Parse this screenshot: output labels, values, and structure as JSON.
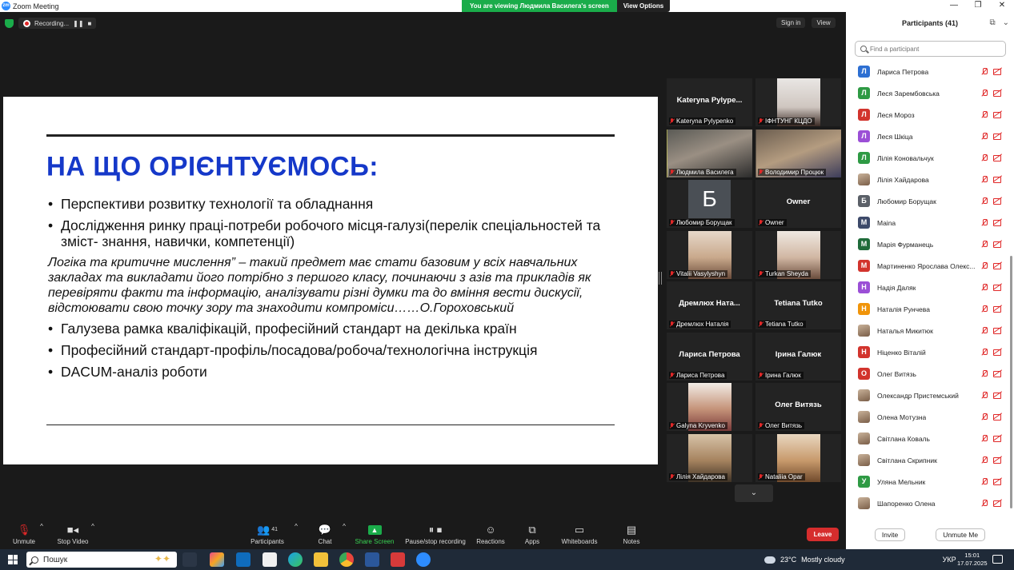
{
  "window": {
    "title": "Zoom Meeting",
    "logo_text": "zm"
  },
  "banner": {
    "viewing": "You are viewing Людмила Василега's screen",
    "view_options": "View Options"
  },
  "window_controls": {
    "minimize": "—",
    "maximize": "❐",
    "close": "✕"
  },
  "recording": {
    "label": "Recording...",
    "pause": "❚❚",
    "stop": "■"
  },
  "top_links": {
    "sign_in": "Sign in",
    "view": "View"
  },
  "slide": {
    "headline": "НА ЩО ОРІЄНТУЄМОСЬ:",
    "bullets_top": [
      "Перспективи розвитку технології та обладнання",
      "Дослідження ринку праці-потреби робочого місця-галузі(перелік спеціальностей та зміст- знання, навички, компетенції)"
    ],
    "quote": "Логіка та критичне мислення” – такий предмет має стати базовим у всіх навчальних закладах та викладати його потрібно з першого класу, починаючи з азів та прикладів як перевіряти факти та інформацію, аналізувати різні думки та до вміння вести дискусії, відстоювати свою точку зору та знаходити компроміси……О.Гороховський",
    "bullets_bottom": [
      "Галузева рамка кваліфікацій, професійний стандарт на декілька країн",
      "Професійний стандарт-профіль/посадова/робоча/технологічна інструкція",
      "DACUM-аналіз роботи"
    ],
    "bullet_char": "•"
  },
  "gallery": [
    {
      "name": "Kateryna Pylype...",
      "label": "Kateryna Pylypenko",
      "kind": "name"
    },
    {
      "name": "",
      "label": "ІФНТУНГ КЦДО",
      "kind": "photo"
    },
    {
      "name": "",
      "label": "Людмила Василега",
      "kind": "photo",
      "active": true
    },
    {
      "name": "",
      "label": "Володимир Процюк",
      "kind": "photo"
    },
    {
      "name": "Б",
      "label": "Любомир Борущак",
      "kind": "letter"
    },
    {
      "name": "Owner",
      "label": "Owner",
      "kind": "name"
    },
    {
      "name": "",
      "label": "Vitalii Vasylyshyn",
      "kind": "photo"
    },
    {
      "name": "",
      "label": "Turkan Sheyda",
      "kind": "photo"
    },
    {
      "name": "Дремлюх  Ната...",
      "label": "Дремлюх Наталія",
      "kind": "name"
    },
    {
      "name": "Tetiana Tutko",
      "label": "Tetiana Tutko",
      "kind": "name"
    },
    {
      "name": "Лариса Петрова",
      "label": "Лариса Петрова",
      "kind": "name"
    },
    {
      "name": "Ірина Галюк",
      "label": "Ірина Галюк",
      "kind": "name"
    },
    {
      "name": "",
      "label": "Galyna Kryvenko",
      "kind": "photo"
    },
    {
      "name": "Олег Витязь",
      "label": "Олег Витязь",
      "kind": "name"
    },
    {
      "name": "",
      "label": "Лілія Хайдарова",
      "kind": "photo"
    },
    {
      "name": "",
      "label": "Nataliia Opar",
      "kind": "photo"
    }
  ],
  "gallery_down": "⌄",
  "participants": {
    "title": "Participants (41)",
    "search_placeholder": "Find a participant",
    "list": [
      {
        "initial": "Л",
        "name": "Лариса Петрова",
        "color": "#2d6fd2"
      },
      {
        "initial": "Л",
        "name": "Леся Зарембовська",
        "color": "#2e9a44"
      },
      {
        "initial": "Л",
        "name": "Леся Мороз",
        "color": "#d2342d"
      },
      {
        "initial": "Л",
        "name": "Леся Шкіца",
        "color": "#9b4fd6"
      },
      {
        "initial": "Л",
        "name": "Лілія Коновальчук",
        "color": "#2e9a44"
      },
      {
        "initial": "",
        "name": "Лілія Хайдарова",
        "color": "photo"
      },
      {
        "initial": "Б",
        "name": "Любомир Борущак",
        "color": "#5b6068"
      },
      {
        "initial": "M",
        "name": "Maina",
        "color": "#3d4a6a"
      },
      {
        "initial": "М",
        "name": "Марія Фурманець",
        "color": "#1f6b3a"
      },
      {
        "initial": "М",
        "name": "Мартиненко Ярослава Олекс...",
        "color": "#d2342d"
      },
      {
        "initial": "Н",
        "name": "Надія Даляк",
        "color": "#9b4fd6"
      },
      {
        "initial": "Н",
        "name": "Наталія Рунчева",
        "color": "#f0940a"
      },
      {
        "initial": "",
        "name": "Наталья Микитюк",
        "color": "photo"
      },
      {
        "initial": "Н",
        "name": "Ніценко Віталій",
        "color": "#d2342d"
      },
      {
        "initial": "О",
        "name": "Олег Витязь",
        "color": "#d2342d"
      },
      {
        "initial": "",
        "name": "Олександр Пристемський",
        "color": "photo"
      },
      {
        "initial": "",
        "name": "Олена Мотузна",
        "color": "photo"
      },
      {
        "initial": "",
        "name": "Світлана Коваль",
        "color": "photo"
      },
      {
        "initial": "",
        "name": "Світлана Скрипник",
        "color": "photo"
      },
      {
        "initial": "У",
        "name": "Уляна Мельник",
        "color": "#2e9a44"
      },
      {
        "initial": "",
        "name": "Шапоренко Олена",
        "color": "photo"
      }
    ],
    "invite": "Invite",
    "unmute_me": "Unmute Me"
  },
  "toolbar": {
    "unmute": "Unmute",
    "stop_video": "Stop Video",
    "participants": "Participants",
    "participants_count": "41",
    "chat": "Chat",
    "share_screen": "Share Screen",
    "pause_stop_recording": "Pause/stop recording",
    "reactions": "Reactions",
    "apps": "Apps",
    "whiteboards": "Whiteboards",
    "notes": "Notes",
    "leave": "Leave",
    "caret": "^"
  },
  "taskbar": {
    "search_label": "Пошук",
    "weather_temp": "23°C",
    "weather_text": "Mostly cloudy",
    "lang": "УКР",
    "time": "15:01",
    "date": "17.07.2025"
  }
}
